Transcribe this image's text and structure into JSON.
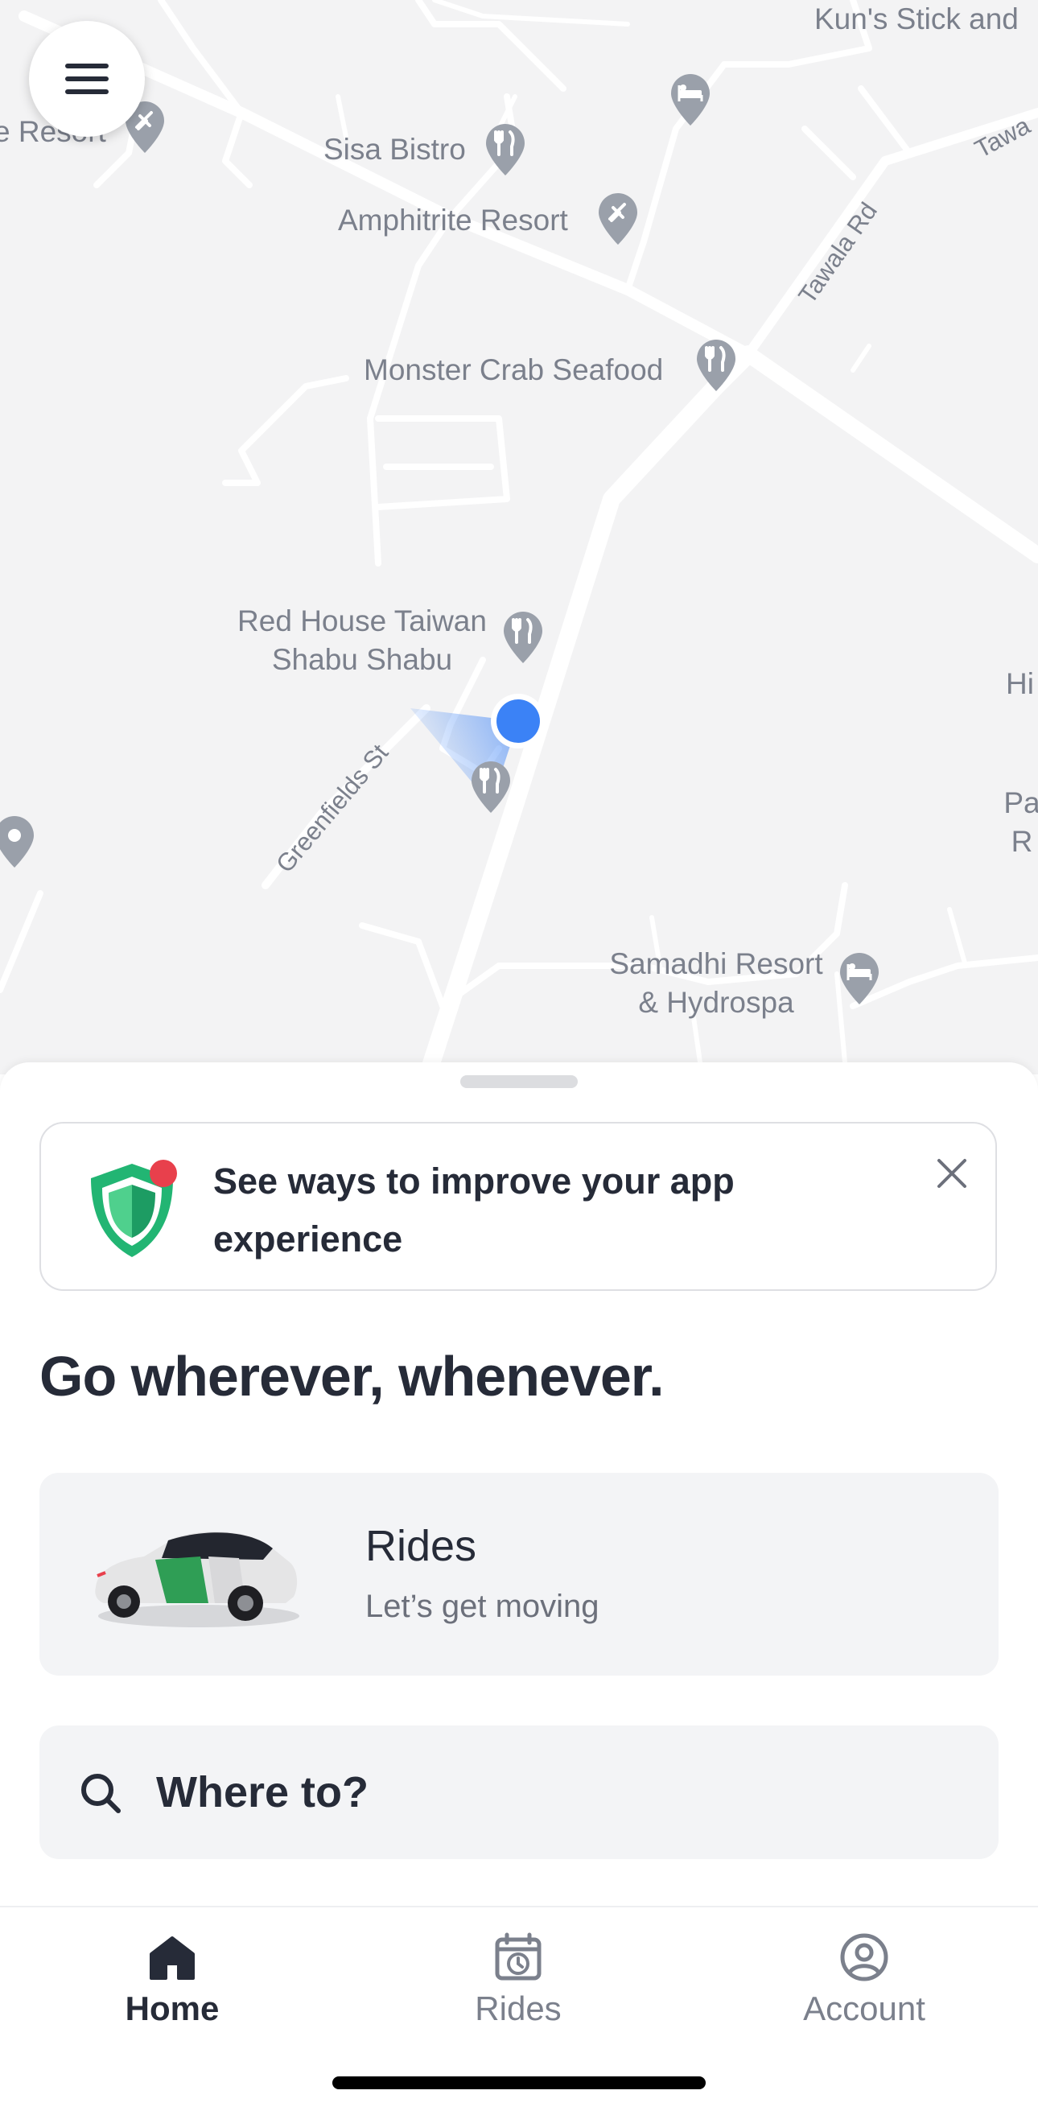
{
  "map": {
    "menu_icon": "hamburger-menu-icon",
    "pois": [
      {
        "name": "Kun's Stick and",
        "icon": "none"
      },
      {
        "name": "e Resort",
        "icon": "resort-icon"
      },
      {
        "name": "Sisa Bistro",
        "icon": "restaurant-icon"
      },
      {
        "name": "Amphitrite Resort",
        "icon": "resort-icon"
      },
      {
        "name": "Monster Crab Seafood",
        "icon": "restaurant-icon"
      },
      {
        "name": "Red House Taiwan",
        "name2": "Shabu Shabu",
        "icon": "restaurant-icon"
      },
      {
        "name": "Samadhi Resort",
        "name2": "& Hydrospa",
        "icon": "hotel-icon"
      },
      {
        "name": "Hi",
        "icon": "none"
      },
      {
        "name": "Pa",
        "name2": "R",
        "icon": "none"
      }
    ],
    "streets": [
      "Tawala Rd",
      "Tawa",
      "Greenfields St"
    ]
  },
  "banner": {
    "icon": "shield-icon",
    "text": "See ways to improve your app experience",
    "close_icon": "close-icon"
  },
  "headline": "Go wherever, whenever.",
  "rides_card": {
    "title": "Rides",
    "subtitle": "Let’s get moving",
    "image": "car-image"
  },
  "search": {
    "icon": "search-icon",
    "placeholder": "Where to?"
  },
  "tabs": [
    {
      "label": "Home",
      "icon": "home-icon",
      "active": true
    },
    {
      "label": "Rides",
      "icon": "calendar-clock-icon",
      "active": false
    },
    {
      "label": "Account",
      "icon": "account-icon",
      "active": false
    }
  ],
  "colors": {
    "accent_blue": "#3b82f6",
    "text_dark": "#262b38",
    "text_muted": "#7b808c",
    "shield_green": "#22b573",
    "notification_red": "#e8404c",
    "map_bg": "#f3f3f4"
  }
}
